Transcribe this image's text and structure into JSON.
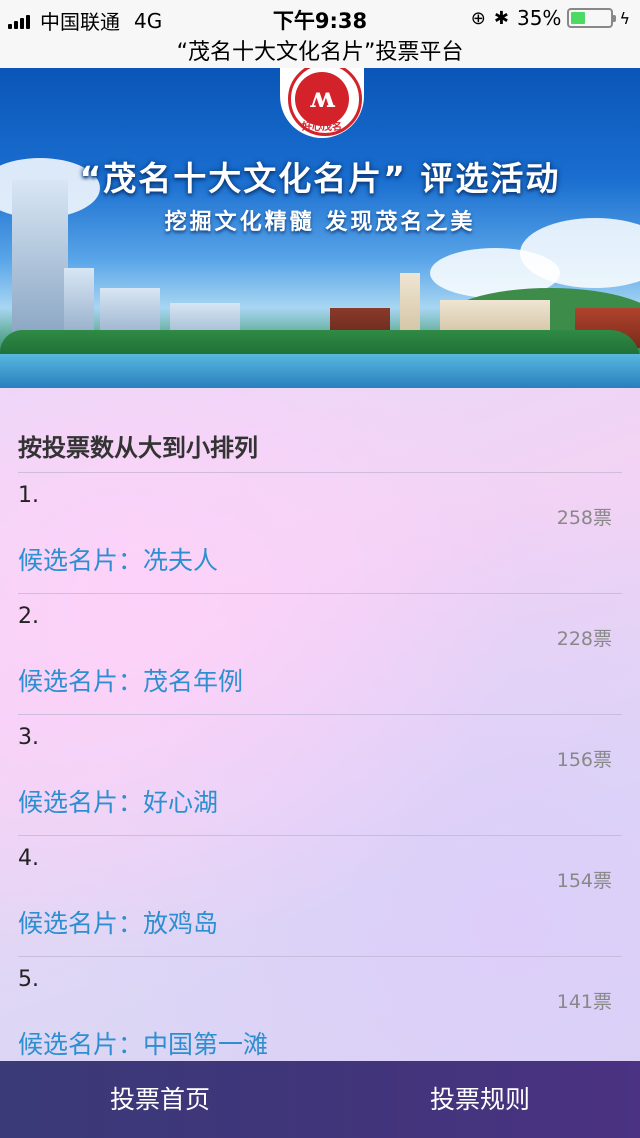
{
  "status_bar": {
    "carrier": "中国联通",
    "network": "4G",
    "time": "下午9:38",
    "battery": "35%",
    "battery_level": 0.35
  },
  "page_title": "“茂名十大文化名片”投票平台",
  "banner": {
    "headline": "“茂名十大文化名片” 评选活动",
    "subline": "挖掘文化精髓 发现茂名之美",
    "logo_text": "好心茂名",
    "logo_arc": "HAOXIN MAOMING"
  },
  "sort_label": "按投票数从大到小排列",
  "candidate_prefix": "候选名片：",
  "items": [
    {
      "rank": "1.",
      "votes": "258票",
      "name": "候选名片：冼夫人"
    },
    {
      "rank": "2.",
      "votes": "228票",
      "name": "候选名片：茂名年例"
    },
    {
      "rank": "3.",
      "votes": "156票",
      "name": "候选名片：好心湖"
    },
    {
      "rank": "4.",
      "votes": "154票",
      "name": "候选名片：放鸡岛"
    },
    {
      "rank": "5.",
      "votes": "141票",
      "name": "候选名片：中国第一滩"
    }
  ],
  "tabs": {
    "home": "投票首页",
    "rules": "投票规则"
  }
}
